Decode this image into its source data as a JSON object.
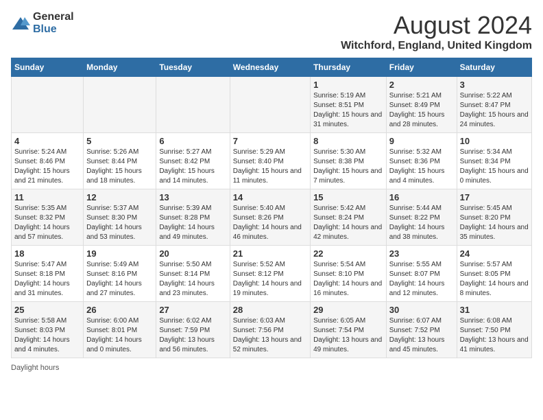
{
  "header": {
    "logo_general": "General",
    "logo_blue": "Blue",
    "main_title": "August 2024",
    "subtitle": "Witchford, England, United Kingdom"
  },
  "days_of_week": [
    "Sunday",
    "Monday",
    "Tuesday",
    "Wednesday",
    "Thursday",
    "Friday",
    "Saturday"
  ],
  "weeks": [
    [
      {
        "day": "",
        "sunrise": "",
        "sunset": "",
        "daylight": ""
      },
      {
        "day": "",
        "sunrise": "",
        "sunset": "",
        "daylight": ""
      },
      {
        "day": "",
        "sunrise": "",
        "sunset": "",
        "daylight": ""
      },
      {
        "day": "",
        "sunrise": "",
        "sunset": "",
        "daylight": ""
      },
      {
        "day": "1",
        "sunrise": "5:19 AM",
        "sunset": "8:51 PM",
        "daylight": "15 hours and 31 minutes."
      },
      {
        "day": "2",
        "sunrise": "5:21 AM",
        "sunset": "8:49 PM",
        "daylight": "15 hours and 28 minutes."
      },
      {
        "day": "3",
        "sunrise": "5:22 AM",
        "sunset": "8:47 PM",
        "daylight": "15 hours and 24 minutes."
      }
    ],
    [
      {
        "day": "4",
        "sunrise": "5:24 AM",
        "sunset": "8:46 PM",
        "daylight": "15 hours and 21 minutes."
      },
      {
        "day": "5",
        "sunrise": "5:26 AM",
        "sunset": "8:44 PM",
        "daylight": "15 hours and 18 minutes."
      },
      {
        "day": "6",
        "sunrise": "5:27 AM",
        "sunset": "8:42 PM",
        "daylight": "15 hours and 14 minutes."
      },
      {
        "day": "7",
        "sunrise": "5:29 AM",
        "sunset": "8:40 PM",
        "daylight": "15 hours and 11 minutes."
      },
      {
        "day": "8",
        "sunrise": "5:30 AM",
        "sunset": "8:38 PM",
        "daylight": "15 hours and 7 minutes."
      },
      {
        "day": "9",
        "sunrise": "5:32 AM",
        "sunset": "8:36 PM",
        "daylight": "15 hours and 4 minutes."
      },
      {
        "day": "10",
        "sunrise": "5:34 AM",
        "sunset": "8:34 PM",
        "daylight": "15 hours and 0 minutes."
      }
    ],
    [
      {
        "day": "11",
        "sunrise": "5:35 AM",
        "sunset": "8:32 PM",
        "daylight": "14 hours and 57 minutes."
      },
      {
        "day": "12",
        "sunrise": "5:37 AM",
        "sunset": "8:30 PM",
        "daylight": "14 hours and 53 minutes."
      },
      {
        "day": "13",
        "sunrise": "5:39 AM",
        "sunset": "8:28 PM",
        "daylight": "14 hours and 49 minutes."
      },
      {
        "day": "14",
        "sunrise": "5:40 AM",
        "sunset": "8:26 PM",
        "daylight": "14 hours and 46 minutes."
      },
      {
        "day": "15",
        "sunrise": "5:42 AM",
        "sunset": "8:24 PM",
        "daylight": "14 hours and 42 minutes."
      },
      {
        "day": "16",
        "sunrise": "5:44 AM",
        "sunset": "8:22 PM",
        "daylight": "14 hours and 38 minutes."
      },
      {
        "day": "17",
        "sunrise": "5:45 AM",
        "sunset": "8:20 PM",
        "daylight": "14 hours and 35 minutes."
      }
    ],
    [
      {
        "day": "18",
        "sunrise": "5:47 AM",
        "sunset": "8:18 PM",
        "daylight": "14 hours and 31 minutes."
      },
      {
        "day": "19",
        "sunrise": "5:49 AM",
        "sunset": "8:16 PM",
        "daylight": "14 hours and 27 minutes."
      },
      {
        "day": "20",
        "sunrise": "5:50 AM",
        "sunset": "8:14 PM",
        "daylight": "14 hours and 23 minutes."
      },
      {
        "day": "21",
        "sunrise": "5:52 AM",
        "sunset": "8:12 PM",
        "daylight": "14 hours and 19 minutes."
      },
      {
        "day": "22",
        "sunrise": "5:54 AM",
        "sunset": "8:10 PM",
        "daylight": "14 hours and 16 minutes."
      },
      {
        "day": "23",
        "sunrise": "5:55 AM",
        "sunset": "8:07 PM",
        "daylight": "14 hours and 12 minutes."
      },
      {
        "day": "24",
        "sunrise": "5:57 AM",
        "sunset": "8:05 PM",
        "daylight": "14 hours and 8 minutes."
      }
    ],
    [
      {
        "day": "25",
        "sunrise": "5:58 AM",
        "sunset": "8:03 PM",
        "daylight": "14 hours and 4 minutes."
      },
      {
        "day": "26",
        "sunrise": "6:00 AM",
        "sunset": "8:01 PM",
        "daylight": "14 hours and 0 minutes."
      },
      {
        "day": "27",
        "sunrise": "6:02 AM",
        "sunset": "7:59 PM",
        "daylight": "13 hours and 56 minutes."
      },
      {
        "day": "28",
        "sunrise": "6:03 AM",
        "sunset": "7:56 PM",
        "daylight": "13 hours and 52 minutes."
      },
      {
        "day": "29",
        "sunrise": "6:05 AM",
        "sunset": "7:54 PM",
        "daylight": "13 hours and 49 minutes."
      },
      {
        "day": "30",
        "sunrise": "6:07 AM",
        "sunset": "7:52 PM",
        "daylight": "13 hours and 45 minutes."
      },
      {
        "day": "31",
        "sunrise": "6:08 AM",
        "sunset": "7:50 PM",
        "daylight": "13 hours and 41 minutes."
      }
    ]
  ],
  "footer": {
    "note": "Daylight hours"
  },
  "colors": {
    "header_bg": "#2e6da4",
    "odd_row": "#f5f5f5",
    "even_row": "#ffffff"
  }
}
